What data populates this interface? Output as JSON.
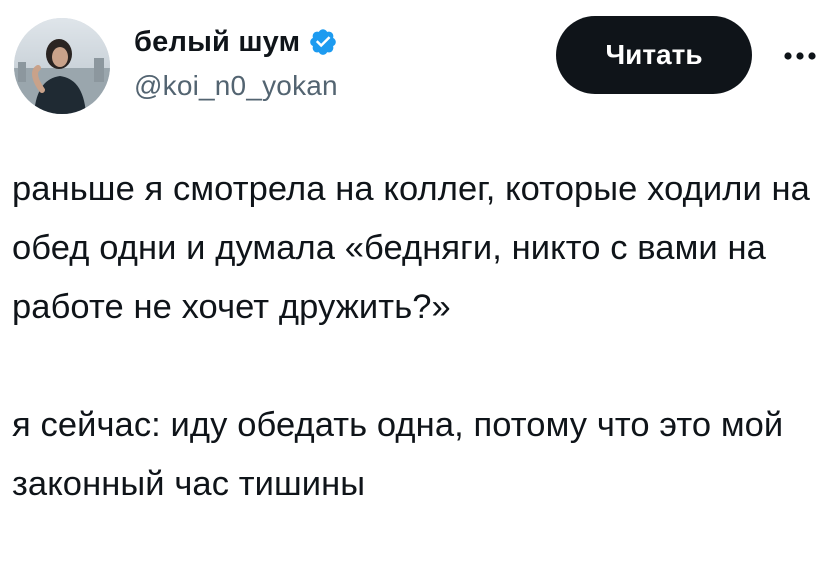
{
  "author": {
    "display_name": "белый шум",
    "handle": "@koi_n0_yokan",
    "verified": true,
    "avatar_icon": "profile-photo"
  },
  "actions": {
    "follow_label": "Читать",
    "more_icon": "more-horizontal-icon"
  },
  "tweet": {
    "paragraphs": [
      "раньше я смотрела на коллег, которые ходили на обед одни и думала «бедняги, никто с вами на работе не хочет дружить?»",
      "я сейчас: иду обедать одна, потому что это мой законный час тишины"
    ]
  },
  "colors": {
    "text": "#0f1419",
    "secondary": "#536471",
    "verified": "#1d9bf0",
    "button_bg": "#0f1419",
    "button_text": "#ffffff"
  }
}
